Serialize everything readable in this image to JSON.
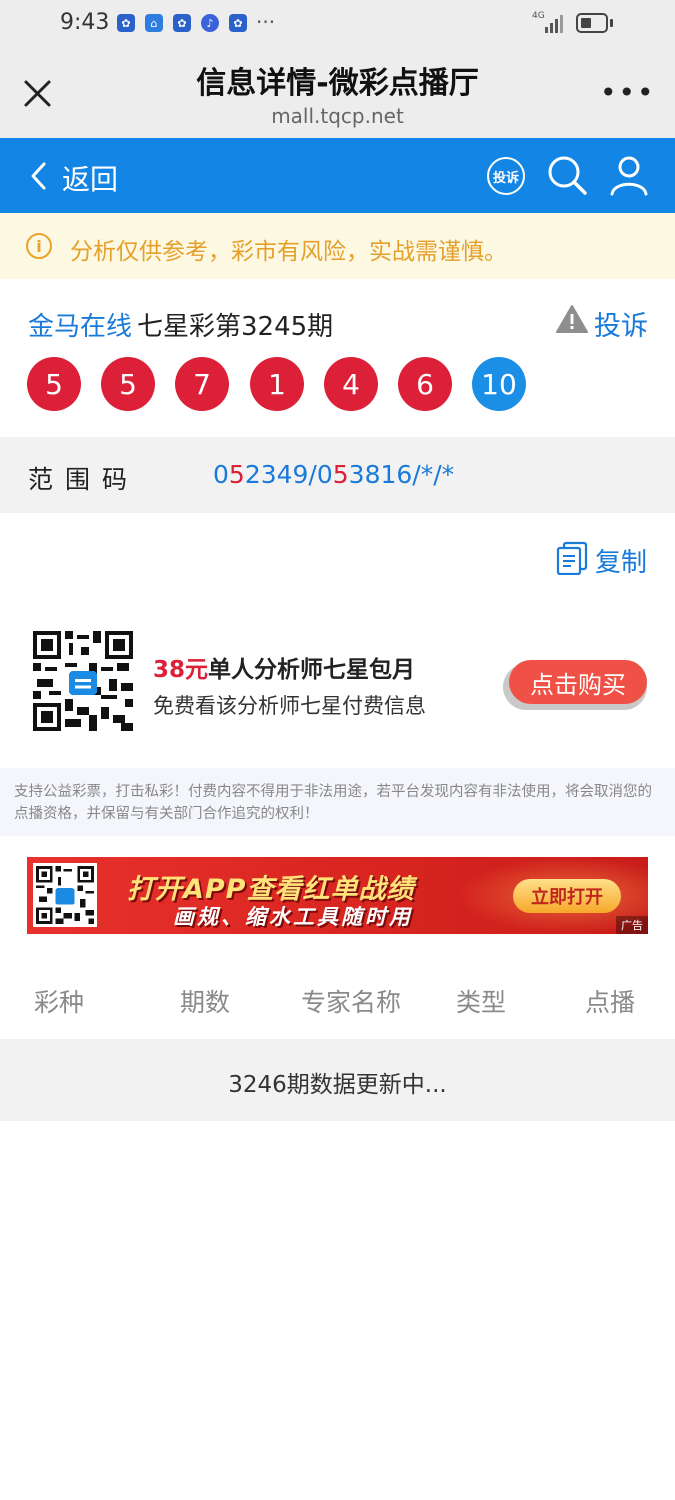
{
  "status_bar": {
    "time": "9:43",
    "ellipsis": "···",
    "network": "4G"
  },
  "browser": {
    "title": "信息详情-微彩点播厅",
    "url": "mall.tqcp.net",
    "more": "•••"
  },
  "header": {
    "back_label": "返回",
    "complain_badge": "投诉"
  },
  "notice": {
    "icon": "i",
    "text": "分析仅供参考，彩市有风险，实战需谨慎。"
  },
  "lottery": {
    "issuer": "金马在线",
    "title": "七星彩第3245期",
    "complain_label": "投诉",
    "balls": [
      "5",
      "5",
      "7",
      "1",
      "4",
      "6",
      "10"
    ],
    "ball_colors": [
      "red",
      "red",
      "red",
      "red",
      "red",
      "red",
      "blue"
    ]
  },
  "range": {
    "label": "范围码",
    "value_part1": "0",
    "value_part2": "5",
    "value_part3": "2349/0",
    "value_part4": "5",
    "value_part5": "3816/*/*"
  },
  "copy_label": "复制",
  "promo": {
    "price": "38元",
    "title_rest": "单人分析师七星包月",
    "subtitle": "免费看该分析师七星付费信息",
    "button": "点击购买"
  },
  "disclaimer": "支持公益彩票，打击私彩！付费内容不得用于非法用途，若平台发现内容有非法使用，将会取消您的点播资格，并保留与有关部门合作追究的权利！",
  "banner": {
    "line1": "打开APP查看红单战绩",
    "line2": "画规、缩水工具随时用",
    "button": "立即打开",
    "ad_tag": "广告"
  },
  "table": {
    "columns": [
      "彩种",
      "期数",
      "专家名称",
      "类型",
      "点播"
    ],
    "status": "3246期数据更新中..."
  },
  "colors": {
    "blue_header": "#1385e5",
    "red_ball": "#db2037",
    "blue_ball": "#1b8ee6",
    "link_blue": "#1a7ad9",
    "buy_button": "#ef5146",
    "notice_text": "#e4a02b"
  }
}
